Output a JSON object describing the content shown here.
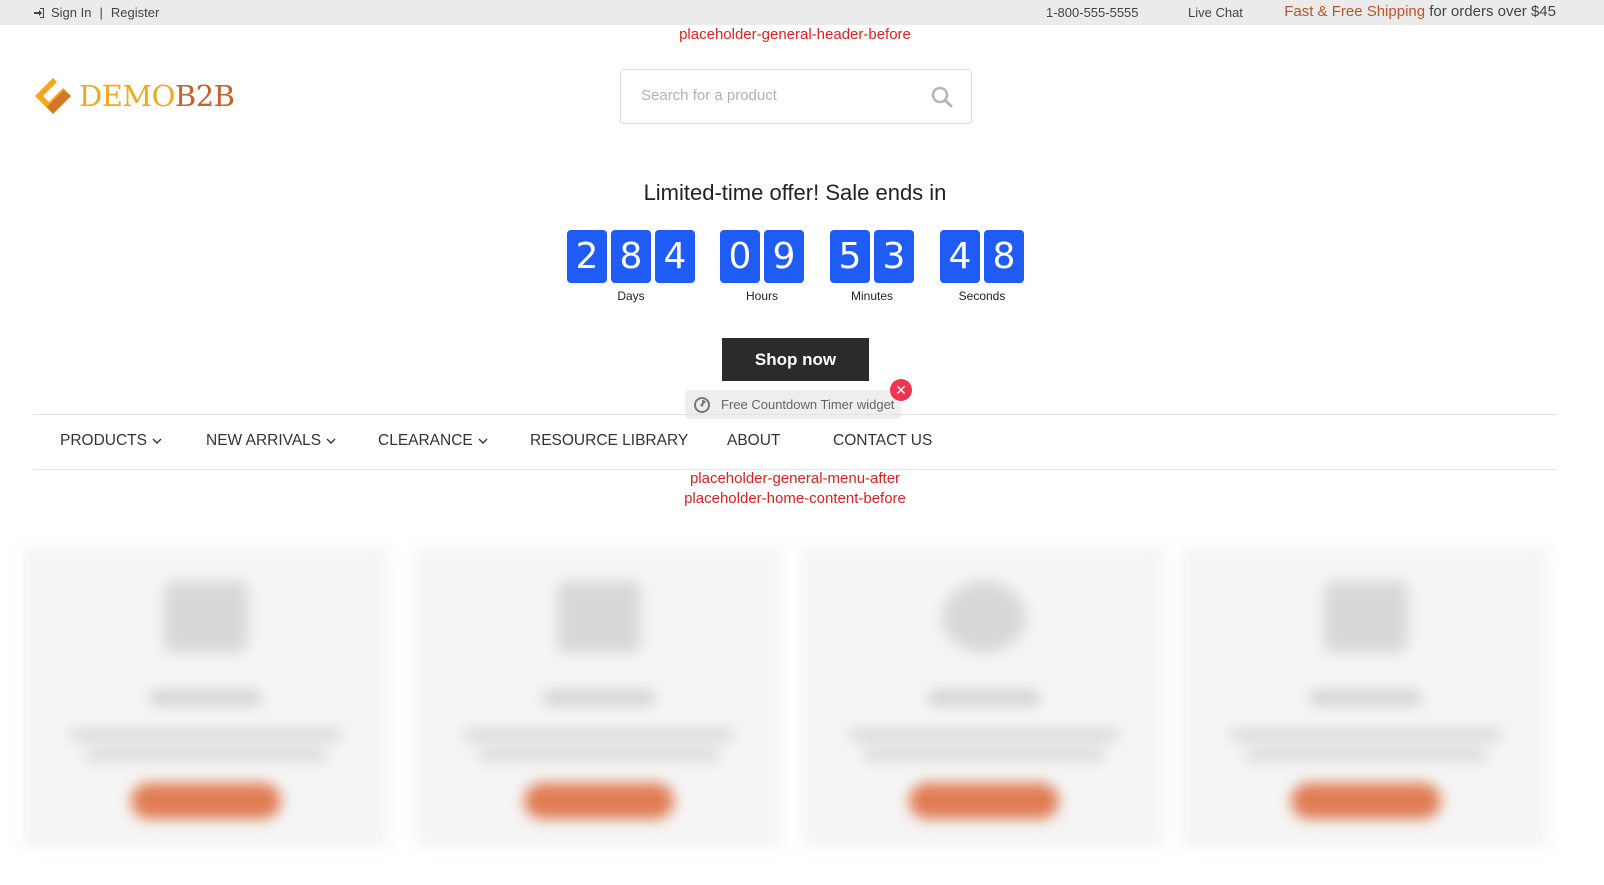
{
  "topbar": {
    "sign_in": "Sign In",
    "separator": "|",
    "register": "Register",
    "phone": "1-800-555-5555",
    "live_chat": "Live Chat",
    "shipping_accent": "Fast & Free Shipping",
    "shipping_rest": " for orders over $45"
  },
  "placeholders": {
    "header_before": "placeholder-general-header-before",
    "menu_after": "placeholder-general-menu-after",
    "home_content_before": "placeholder-home-content-before"
  },
  "logo": {
    "part1": "DEMO",
    "part2": "B2B",
    "colors": {
      "part1": "#f0a81c",
      "part2": "#c6612a"
    }
  },
  "search": {
    "placeholder": "Search for a product",
    "icon": "search-icon"
  },
  "countdown": {
    "title": "Limited-time offer! Sale ends in",
    "days": {
      "digits": [
        "2",
        "8",
        "4"
      ],
      "label": "Days"
    },
    "hours": {
      "digits": [
        "0",
        "9"
      ],
      "label": "Hours"
    },
    "minutes": {
      "digits": [
        "5",
        "3"
      ],
      "label": "Minutes"
    },
    "seconds": {
      "digits": [
        "4",
        "8"
      ],
      "label": "Seconds"
    },
    "digit_color": "#1e5cf5"
  },
  "shop_button": {
    "label": "Shop now"
  },
  "widget_badge": {
    "label": "Free Countdown Timer widget",
    "close": "✕"
  },
  "nav": {
    "items": [
      {
        "label": "PRODUCTS",
        "dropdown": true
      },
      {
        "label": "NEW ARRIVALS",
        "dropdown": true
      },
      {
        "label": "CLEARANCE",
        "dropdown": true
      },
      {
        "label": "RESOURCE LIBRARY",
        "dropdown": false
      },
      {
        "label": "ABOUT",
        "dropdown": false
      },
      {
        "label": "CONTACT US",
        "dropdown": false
      }
    ]
  },
  "colors": {
    "accent": "#c0522a",
    "placeholder_text": "#e0201b",
    "close_badge": "#f0344f",
    "card_button": "#e07c52"
  }
}
